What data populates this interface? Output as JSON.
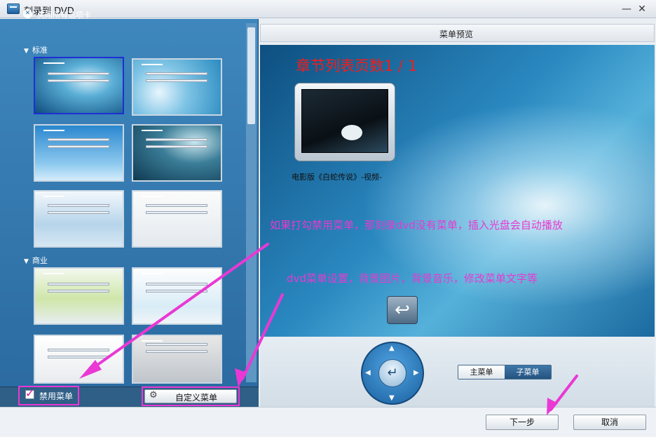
{
  "window": {
    "title": "刻录到 DVD",
    "minimize": "—",
    "close": "✕"
  },
  "left": {
    "close_all_label": "关闭所有选项卡",
    "categories": [
      "标准",
      "商业"
    ],
    "disable_menu_label": "禁用菜单",
    "custom_menu_label": "自定义菜单"
  },
  "preview": {
    "header": "菜单预览",
    "pages_title": "章节列表页数1 / 1",
    "chapter_label": "电影版《白蛇传说》-视频-",
    "note_disable": "如果打勾禁用菜单，那刻录dvd没有菜单，插入光盘会自动播放",
    "note_custom": "dvd菜单设置，背景图片，背景音乐，修改菜单文字等",
    "main_menu": "主菜单",
    "sub_menu": "子菜单"
  },
  "buttons": {
    "next": "下一步",
    "cancel": "取消"
  },
  "colors": {
    "annotation": "#e63ad0",
    "title_red": "#f11d1d",
    "selected_border": "#1e2fd4"
  }
}
